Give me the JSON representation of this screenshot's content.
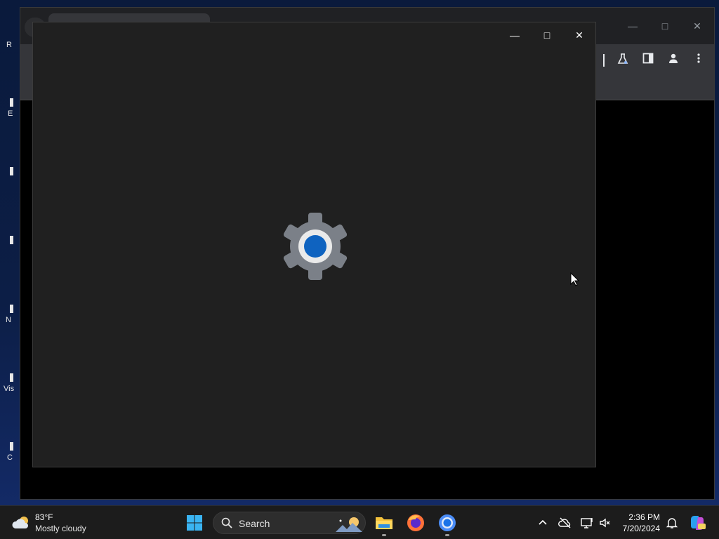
{
  "desktop": {
    "icons": [
      {
        "label": "R"
      },
      {
        "label": "E"
      },
      {
        "label": ""
      },
      {
        "label": ""
      },
      {
        "label": "N"
      },
      {
        "label": "Vis"
      },
      {
        "label": "C"
      }
    ]
  },
  "settings_window": {
    "state": "loading",
    "icon": "gear-icon",
    "accent_color": "#0f63c0"
  },
  "taskbar": {
    "weather": {
      "temperature": "83°F",
      "condition": "Mostly cloudy"
    },
    "search": {
      "placeholder": "Search"
    },
    "apps": [
      "windows-start-icon",
      "file-explorer-icon",
      "firefox-icon",
      "chrome-icon"
    ],
    "tray": {
      "time": "2:36 PM",
      "date": "7/20/2024"
    }
  }
}
